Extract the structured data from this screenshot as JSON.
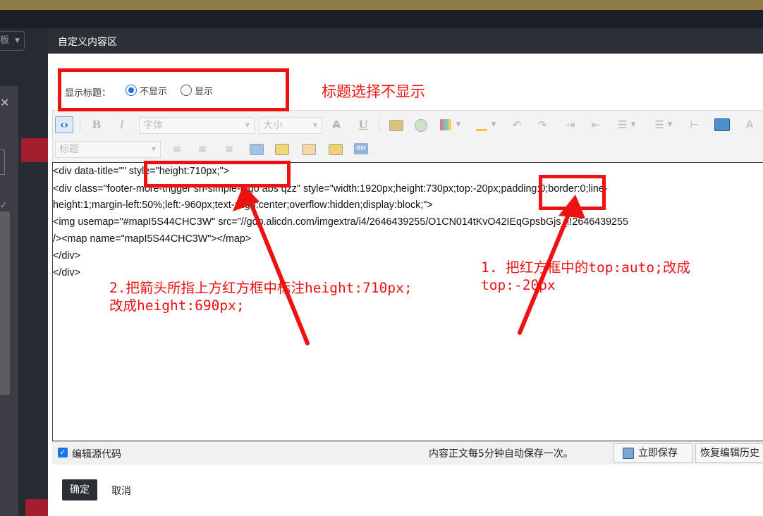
{
  "background": {
    "select_text": "板",
    "close_glyph": "✕"
  },
  "dialog": {
    "title": "自定义内容区"
  },
  "title_setting": {
    "label": "显示标题：",
    "options": [
      "不显示",
      "显示"
    ],
    "selected": "不显示"
  },
  "toolbar": {
    "font_combo": "字体",
    "size_combo": "大小",
    "heading_combo": "标题",
    "icons": [
      "source-code-icon",
      "bold-icon",
      "italic-icon",
      "strikethrough-icon",
      "underline-icon",
      "image-icon",
      "emoticon-icon",
      "table-icon",
      "fill-color-icon",
      "undo-icon",
      "redo-icon",
      "indent-icon",
      "outdent-icon",
      "unordered-list-icon",
      "ordered-list-icon",
      "horizontal-rule-icon",
      "preview-icon",
      "clear-format-icon",
      "align-left-icon",
      "align-center-icon",
      "align-right-icon",
      "grid-icon",
      "glasses-icon",
      "frame-icon",
      "split-icon",
      "bm-icon"
    ]
  },
  "editor": {
    "lines": [
      "<div data-title=\"\" style=\"height:710px;\">",
      "        <div class=\"footer-more-trigger sn-simple-logo abs qzz\" style=\"width:1920px;height:730px;top:-20px;padding:0;border:0;line-",
      "height:1;margin-left:50%;left:-960px;text-align:center;overflow:hidden;display:block;\">",
      "                <img usemap=\"#mapI5S44CHC3W\" src=\"//gdp.alicdn.com/imgextra/i4/2646439255/O1CN014tKvO42IEqGpsbGjs_!!2646439255",
      "/><map name=\"mapI5S44CHC3W\"></map>",
      "        </div>",
      "</div>"
    ]
  },
  "footer": {
    "edit_source_label": "编辑源代码",
    "edit_source_checked": true,
    "autosave_text": "内容正文每5分钟自动保存一次。",
    "save_now": "立即保存",
    "restore": "恢复编辑历史"
  },
  "actions": {
    "ok": "确定",
    "cancel": "取消"
  },
  "annotations": {
    "title_note": "标题选择不显示",
    "note1_line1": "1. 把红方框中的top:auto;改成",
    "note1_line2": "top:-20px",
    "note2_line1": "2.把箭头所指上方红方框中标注height:710px;",
    "note2_line2": "改成height:690px;",
    "color": "#ee1111"
  },
  "colors": {
    "accent": "#1a73e8",
    "dialog_header": "#2b2f36",
    "annotation": "#ee1111"
  }
}
